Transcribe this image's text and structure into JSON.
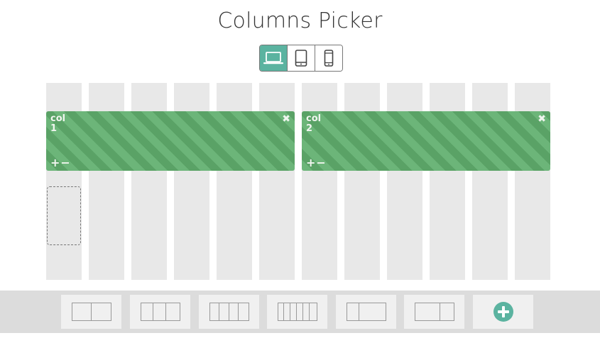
{
  "header": {
    "title": "Columns Picker"
  },
  "devices": [
    {
      "icon": "laptop-icon",
      "active": true
    },
    {
      "icon": "tablet-icon",
      "active": false
    },
    {
      "icon": "phone-icon",
      "active": false
    }
  ],
  "grid": {
    "track_count": 12,
    "columns": [
      {
        "label_line1": "col",
        "label_line2": "1",
        "close": "✖",
        "add": "+",
        "remove": "−",
        "span": 6
      },
      {
        "label_line1": "col",
        "label_line2": "2",
        "close": "✖",
        "add": "+",
        "remove": "−",
        "span": 6
      }
    ]
  },
  "presets": [
    {
      "name": "two-equal",
      "cols": [
        1,
        1
      ]
    },
    {
      "name": "three-equal",
      "cols": [
        1,
        1,
        1
      ]
    },
    {
      "name": "four-equal",
      "cols": [
        1,
        1,
        1,
        1
      ]
    },
    {
      "name": "six-equal",
      "cols": [
        1,
        1,
        1,
        1,
        1,
        1
      ]
    },
    {
      "name": "narrow-wide",
      "cols": [
        1,
        2
      ]
    },
    {
      "name": "wide-narrow",
      "cols": [
        2,
        1
      ]
    }
  ],
  "colors": {
    "accent": "#5bb3a0",
    "column_green": "#5fa86c",
    "track": "#e8e8e8"
  }
}
